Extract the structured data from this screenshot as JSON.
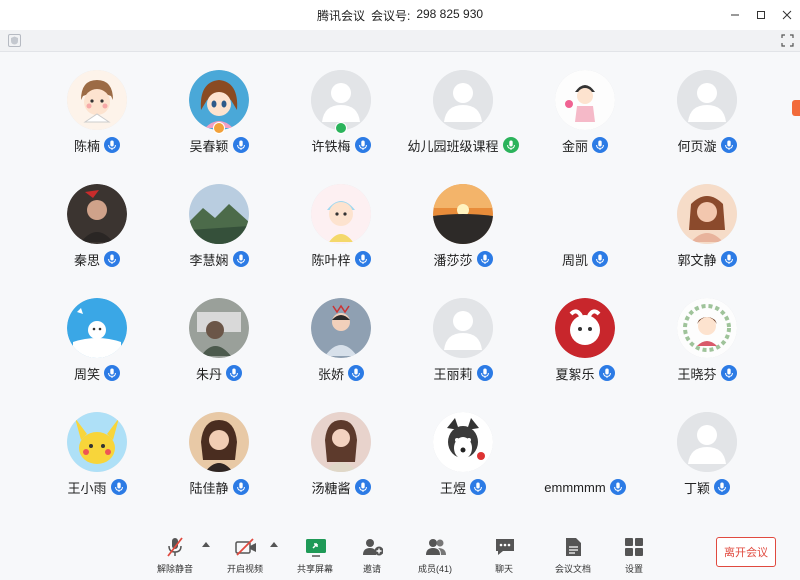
{
  "window": {
    "app_name": "腾讯会议",
    "meeting_label": "会议号:",
    "meeting_id": "298 825 930"
  },
  "colors": {
    "mic_blue": "#2c7be5",
    "mic_green": "#2bb35b",
    "host_green": "#2bb35b",
    "host_orange": "#f2a13a",
    "leave_red": "#e04a3f"
  },
  "participants": [
    {
      "name": "陈楠",
      "avatar": "cartoon-girl",
      "mic": "blue",
      "badge": ""
    },
    {
      "name": "吴春颖",
      "avatar": "anime-girl",
      "mic": "blue",
      "badge": "orange"
    },
    {
      "name": "许铁梅",
      "avatar": "default",
      "mic": "blue",
      "badge": "green"
    },
    {
      "name": "幼儿园班级课程",
      "avatar": "default",
      "mic": "green",
      "badge": ""
    },
    {
      "name": "金丽",
      "avatar": "cartoon-doll",
      "mic": "blue",
      "badge": ""
    },
    {
      "name": "何页漩",
      "avatar": "default",
      "mic": "blue",
      "badge": ""
    },
    {
      "name": "秦思",
      "avatar": "photo-dark",
      "mic": "blue",
      "badge": ""
    },
    {
      "name": "李慧娴",
      "avatar": "photo-landscape",
      "mic": "blue",
      "badge": ""
    },
    {
      "name": "陈叶梓",
      "avatar": "cartoon-baby",
      "mic": "blue",
      "badge": ""
    },
    {
      "name": "潘莎莎",
      "avatar": "photo-sunset",
      "mic": "blue",
      "badge": ""
    },
    {
      "name": "周凯",
      "avatar": "none",
      "mic": "blue",
      "badge": ""
    },
    {
      "name": "郭文静",
      "avatar": "photo-warm",
      "mic": "blue",
      "badge": ""
    },
    {
      "name": "周笑",
      "avatar": "cartoon-blue",
      "mic": "blue",
      "badge": ""
    },
    {
      "name": "朱丹",
      "avatar": "photo-grey",
      "mic": "blue",
      "badge": ""
    },
    {
      "name": "张娇",
      "avatar": "photo-child",
      "mic": "blue",
      "badge": ""
    },
    {
      "name": "王丽莉",
      "avatar": "default",
      "mic": "blue",
      "badge": ""
    },
    {
      "name": "夏絮乐",
      "avatar": "cartoon-red",
      "mic": "blue",
      "badge": ""
    },
    {
      "name": "王晓芬",
      "avatar": "cartoon-wreath",
      "mic": "blue",
      "badge": ""
    },
    {
      "name": "王小雨",
      "avatar": "cartoon-pikachu",
      "mic": "blue",
      "badge": ""
    },
    {
      "name": "陆佳静",
      "avatar": "photo-woman",
      "mic": "blue",
      "badge": ""
    },
    {
      "name": "汤糖酱",
      "avatar": "photo-pink",
      "mic": "blue",
      "badge": ""
    },
    {
      "name": "王煜",
      "avatar": "photo-husky",
      "mic": "blue",
      "badge": ""
    },
    {
      "name": "emmmmm",
      "avatar": "none",
      "mic": "blue",
      "badge": ""
    },
    {
      "name": "丁颖",
      "avatar": "default",
      "mic": "blue",
      "badge": ""
    }
  ],
  "toolbar": {
    "unmute": "解除静音",
    "start_video": "开启视频",
    "share_screen": "共享屏幕",
    "invite": "邀请",
    "members": "成员(41)",
    "chat": "聊天",
    "docs": "会议文档",
    "settings": "设置",
    "leave": "离开会议"
  }
}
